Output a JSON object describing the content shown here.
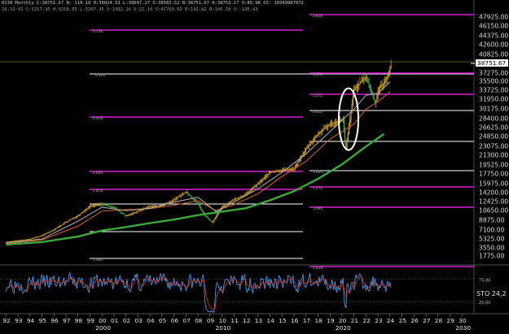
{
  "header": {
    "line1": "US30 Monthly C:38751.67 N: 119.19 H:39024.53 L:38647.27 O:38565.52 B:38751.67 A:38753.17 V:89.9K OI: 10243087072",
    "line2": "18-31-02 C:3257.35 H:3258.55 L:3267.35 V:3392.16 V:21.10 V:47760.69 R:192.82 R:106.18 V:-136.43"
  },
  "chart_data": [
    {
      "type": "line",
      "name": "price",
      "y_axis_labels": [
        "47925.00",
        "46150.00",
        "44375.00",
        "42600.00",
        "40825.00",
        "38751.67",
        "37275.00",
        "35500.00",
        "33725.00",
        "31950.00",
        "30175.00",
        "28400.00",
        "26625.00",
        "24850.00",
        "23075.00",
        "21300.00",
        "19525.00",
        "17750.00",
        "15975.00",
        "14200.00",
        "12425.00",
        "10650.00",
        "8875.00",
        "7100.00",
        "5325.00",
        "3550.00",
        "1775.00"
      ],
      "last_price": "38751.67",
      "ylim": [
        0,
        49000
      ],
      "x_ticks": [
        "92",
        "93",
        "94",
        "95",
        "96",
        "97",
        "98",
        "99",
        "00",
        "01",
        "02",
        "03",
        "04",
        "05",
        "06",
        "07",
        "08",
        "09",
        "10",
        "11",
        "12",
        "13",
        "14",
        "15",
        "16",
        "17",
        "18",
        "19",
        "20",
        "21",
        "22",
        "23",
        "24",
        "25",
        "26",
        "27",
        "28",
        "29",
        "30"
      ],
      "x_decades": [
        "2000",
        "2010",
        "2020",
        "2030"
      ],
      "series": [
        {
          "color": "#c9a227",
          "x": [
            1992,
            1994,
            1995,
            1996,
            1997,
            1998,
            1999,
            2000,
            2001,
            2002,
            2003,
            2004,
            2005,
            2006,
            2007,
            2008,
            2008.5,
            2009.2,
            2010,
            2011,
            2012,
            2013,
            2014,
            2015,
            2016,
            2017,
            2018,
            2019,
            2020.1,
            2020.3,
            2021,
            2022,
            2022.8,
            2023,
            2023.6,
            2024.1
          ],
          "y": [
            3300,
            3900,
            4600,
            5800,
            7300,
            8600,
            10500,
            11000,
            10200,
            8500,
            9500,
            10500,
            10600,
            11800,
            13400,
            11000,
            8800,
            7200,
            10400,
            11800,
            12900,
            15000,
            17300,
            17800,
            18000,
            22000,
            25000,
            27000,
            28000,
            21500,
            34000,
            36500,
            31000,
            34000,
            35500,
            38751
          ]
        },
        {
          "color": "#3aaa3a",
          "x": [
            1992,
            1995,
            1998,
            2000,
            2002,
            2004,
            2006,
            2008,
            2010,
            2012,
            2014,
            2016,
            2018,
            2020,
            2022,
            2023.5
          ],
          "y": [
            2800,
            3300,
            4400,
            5600,
            6300,
            7100,
            7800,
            8700,
            9400,
            10100,
            11700,
            13500,
            16000,
            18900,
            22500,
            25000
          ]
        },
        {
          "color": "#c85a1e",
          "x": [
            1992,
            1995,
            1998,
            2000,
            2002,
            2004,
            2006,
            2008,
            2009.5,
            2011,
            2013,
            2015,
            2017,
            2019,
            2021,
            2022,
            2023,
            2024
          ],
          "y": [
            3000,
            3700,
            6500,
            9500,
            9800,
            10000,
            10700,
            11600,
            9600,
            10800,
            13000,
            16500,
            19500,
            24000,
            27000,
            30000,
            31500,
            33500
          ]
        },
        {
          "color": "#a8a8a8",
          "x": [
            1992,
            1995,
            1998,
            2000,
            2002,
            2004,
            2006,
            2008,
            2009.5,
            2011,
            2013,
            2015,
            2017,
            2019,
            2021,
            2022,
            2023,
            2024
          ],
          "y": [
            3100,
            3900,
            7500,
            10300,
            9600,
            10100,
            11300,
            12300,
            9400,
            11300,
            14000,
            17300,
            21000,
            25500,
            30000,
            32800,
            33200,
            35500
          ]
        }
      ],
      "level_labels": [
        "0.236",
        "0.618",
        "0.618",
        "1.000",
        "0.500",
        "1.000",
        "1.000",
        "1.618",
        "1.272",
        "1.618",
        "1.272",
        "0.500",
        "0.618",
        "1.000",
        "1.272",
        "1.618",
        "1.618",
        "2.618",
        "0.618"
      ],
      "annotations": [
        "ellipse around 2020 low"
      ]
    },
    {
      "type": "line",
      "name": "stochastic",
      "label": "STO",
      "value": "24,2",
      "y_axis_labels": [
        "75.00",
        "25.00"
      ],
      "ylim": [
        0,
        100
      ]
    }
  ]
}
